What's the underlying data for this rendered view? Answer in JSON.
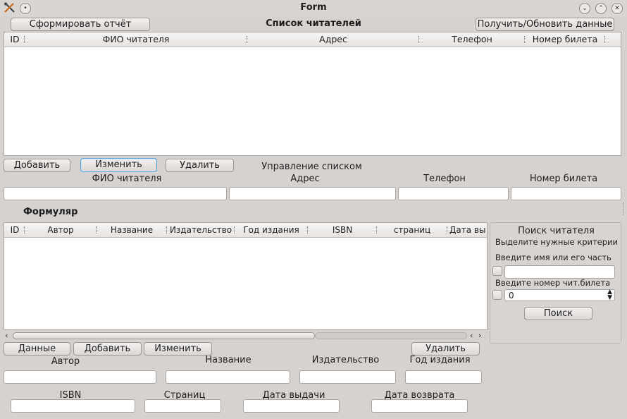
{
  "window": {
    "title": "Form"
  },
  "top": {
    "report_button": "Сформировать отчёт",
    "list_title": "Список читателей",
    "refresh_button": "Получить/Обновить данные"
  },
  "readers_table": {
    "columns": [
      "ID",
      "ФИО читателя",
      "Адрес",
      "Телефон",
      "Номер билета"
    ]
  },
  "list_controls": {
    "add": "Добавить",
    "edit": "Изменить",
    "delete": "Удалить",
    "caption": "Управление списком"
  },
  "reader_fields": {
    "name": "ФИО читателя",
    "address": "Адрес",
    "phone": "Телефон",
    "ticket": "Номер билета"
  },
  "form_section": {
    "title": "Формуляр"
  },
  "books_table": {
    "columns": [
      "ID",
      "Автор",
      "Название",
      "Издательство",
      "Год издания",
      "ISBN",
      "страниц",
      "Дата вы"
    ]
  },
  "search": {
    "title": "Поиск читателя",
    "hint": "Выделите нужные критерии",
    "name_label": "Введите имя или его часть",
    "ticket_label": "Введите номер чит.билета",
    "ticket_value": "0",
    "search_button": "Поиск"
  },
  "book_controls": {
    "data": "Данные",
    "add": "Добавить",
    "edit": "Изменить",
    "delete": "Удалить"
  },
  "book_fields": {
    "author": "Автор",
    "title": "Название",
    "publisher": "Издательство",
    "year": "Год издания",
    "isbn": "ISBN",
    "pages": "Страниц",
    "issue_date": "Дата выдачи",
    "return_date": "Дата возврата"
  },
  "icons": {
    "app": "tools-icon",
    "menu": "circle-menu-icon",
    "minimize": "chevron-down-icon",
    "maximize": "chevron-up-icon",
    "close": "close-icon"
  }
}
